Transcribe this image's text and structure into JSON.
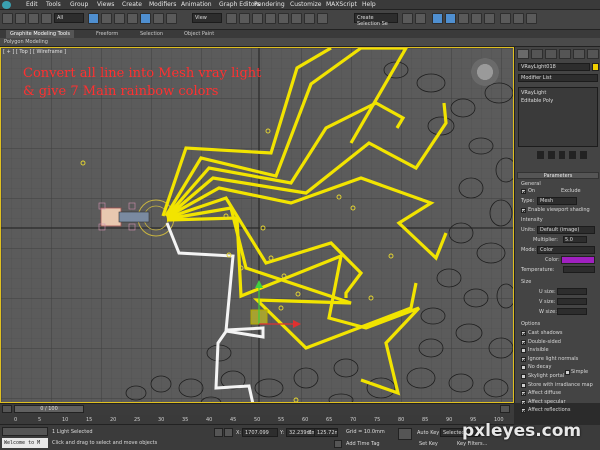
{
  "menu": [
    "Edit",
    "Tools",
    "Group",
    "Views",
    "Create",
    "Modifiers",
    "Animation",
    "Graph Editors",
    "Rendering",
    "Customize",
    "MAXScript",
    "Help"
  ],
  "toolbar": {
    "filter": "All",
    "view": "View",
    "selection_set": "Create Selection Se"
  },
  "ribbon": {
    "tabs": [
      "Graphite Modeling Tools",
      "Freeform",
      "Selection",
      "Object Paint"
    ],
    "sub": "Polygon Modeling"
  },
  "viewport": {
    "label": "[ + ] [ Top ] [ Wireframe ]",
    "annotation_line1": "Convert all line into Mesh vray light",
    "annotation_line2": "& give 7 Main rainbow colors"
  },
  "panel": {
    "object_name": "VRayLight018",
    "modifier_list": "Modifier List",
    "stack": [
      "VRayLight",
      "Editable Poly"
    ],
    "rollout_parameters": "Parameters",
    "general": "General",
    "on_label": "On",
    "exclude_label": "Exclude",
    "type_label": "Type:",
    "type_value": "Mesh",
    "enable_viewport_shading": "Enable viewport shading",
    "intensity": "Intensity",
    "units_label": "Units:",
    "units_value": "Default (image)",
    "multiplier_label": "Multiplier:",
    "multiplier_value": "5.0",
    "mode_label": "Mode:",
    "mode_value": "Color",
    "color_label": "Color:",
    "temperature_label": "Temperature:",
    "size": "Size",
    "u_size": "U size:",
    "v_size": "V size:",
    "w_size": "W size:",
    "options": "Options",
    "opt_items": [
      "Cast shadows",
      "Double-sided",
      "Invisible",
      "Ignore light normals",
      "No decay",
      "Skylight portal",
      "Store with irradiance map",
      "Affect diffuse",
      "Affect specular",
      "Affect reflections"
    ],
    "opt_checked": [
      true,
      true,
      false,
      true,
      false,
      false,
      false,
      true,
      true,
      true
    ],
    "simple_label": "Simple",
    "color_swatch": "#a020c0"
  },
  "timeline": {
    "frame": "0 / 100",
    "ticks": [
      "0",
      "5",
      "10",
      "15",
      "20",
      "25",
      "30",
      "35",
      "40",
      "45",
      "50",
      "55",
      "60",
      "65",
      "70",
      "75",
      "80",
      "85",
      "90",
      "95",
      "100"
    ]
  },
  "status": {
    "selection": "1 Light Selected",
    "hint": "Click and drag to select and move objects",
    "x_label": "X:",
    "x_value": "1707.099",
    "y_label": "Y:",
    "y_value": "32.239mm",
    "z_label": "Z:",
    "z_value": "125.72mm",
    "grid": "Grid = 10.0mm",
    "add_time_tag": "Add Time Tag",
    "auto_key": "Auto Key",
    "set_key": "Set Key",
    "selected": "Selected",
    "key_filters": "Key Filters...",
    "welcome": "Welcome to M"
  },
  "watermark": "pxleyes.com",
  "colors": {
    "bolt_yellow": "#f2e400",
    "white_path": "#f4f4f4",
    "annotation": "#ff3030",
    "viewport_bg": "#5b5b5b"
  }
}
